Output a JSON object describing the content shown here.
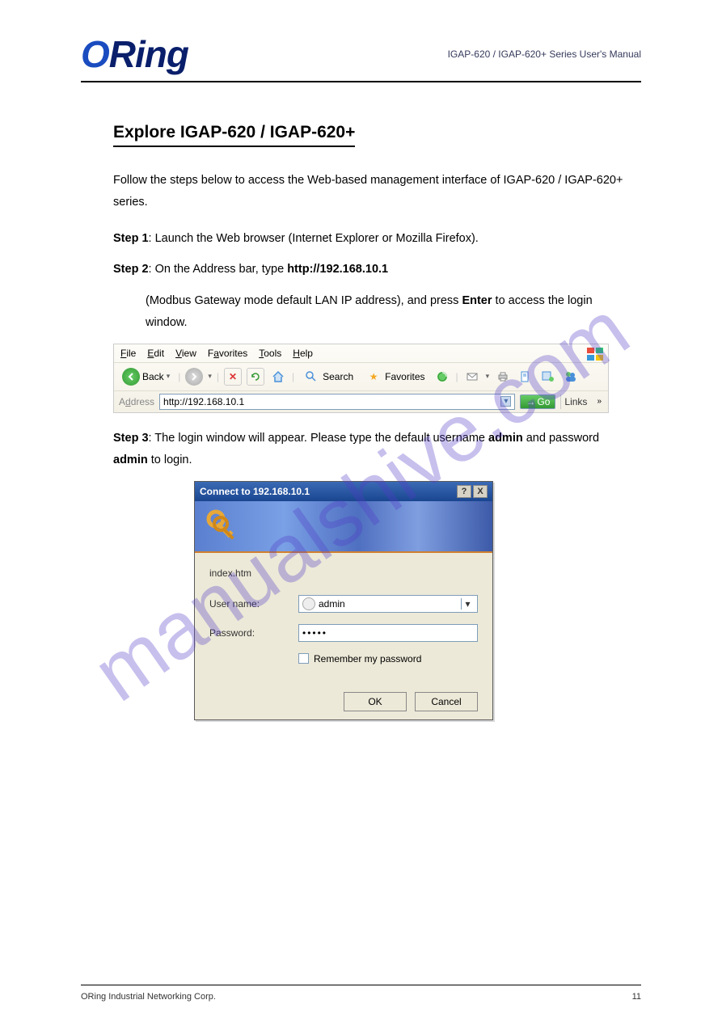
{
  "header": {
    "logo_o": "O",
    "logo_ring": "Ring",
    "product": "IGAP-620 / IGAP-620+ Series User's Manual"
  },
  "section_title": "Explore IGAP-620 / IGAP-620+",
  "intro_line1_prefix": "Follow the steps below to access the Web-based management interface of ",
  "intro_line1_product": "IGAP-620 / IGAP-620+",
  "intro_line1_suffix": " series.",
  "step1_label": "Step 1",
  "step1_text": ": Launch the Web browser (Internet Explorer or Mozilla Firefox).",
  "step2_label": "Step 2",
  "step2_text_a": ": On the Address bar, type",
  "step2_url": "http://192.168.10.1",
  "step2_text_b": "(Modbus Gateway mode default LAN IP address), and press ",
  "step2_enter": "Enter",
  "step2_text_c": " to access the login window.",
  "ie": {
    "menu_file": "File",
    "menu_edit": "Edit",
    "menu_view": "View",
    "menu_favorites": "Favorites",
    "menu_tools": "Tools",
    "menu_help": "Help",
    "back_label": "Back",
    "search_label": "Search",
    "favorites_label": "Favorites",
    "address_label": "Address",
    "address_value": "http://192.168.10.1",
    "go_label": "Go",
    "links_label": "Links"
  },
  "step3_label": "Step 3",
  "step3_text": ": The login window will appear. Please type the default username ",
  "step3_user": "admin",
  "step3_text2": " and password ",
  "step3_pass": "admin",
  "step3_text3": " to login.",
  "dialog": {
    "title": "Connect to 192.168.10.1",
    "help_btn": "?",
    "close_btn": "X",
    "realm": "index.htm",
    "username_label": "User name:",
    "username_value": "admin",
    "password_label": "Password:",
    "password_value": "•••••",
    "remember_label": "Remember my password",
    "ok": "OK",
    "cancel": "Cancel"
  },
  "watermark": "manualshive.com",
  "footer": {
    "left": "ORing Industrial Networking Corp.",
    "right": "11"
  }
}
